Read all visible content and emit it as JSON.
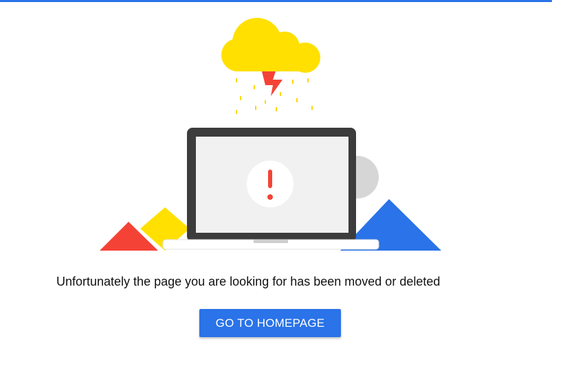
{
  "message": "Unfortunately the page you are looking for has been moved or deleted",
  "button": {
    "label": "GO TO HOMEPAGE"
  },
  "colors": {
    "accent_blue": "#2a73e8",
    "cloud_yellow": "#ffe000",
    "lightning_red": "#f44336",
    "triangle_red": "#f44336",
    "triangle_yellow": "#ffe000",
    "triangle_blue": "#2a73e8",
    "laptop_frame": "#3c3c3c",
    "screen_bg": "#f1f1f1",
    "circle_gray": "#d6d6d6"
  },
  "icons": {
    "error": "exclamation-icon",
    "weather": "storm-cloud-icon",
    "device": "laptop-icon"
  }
}
